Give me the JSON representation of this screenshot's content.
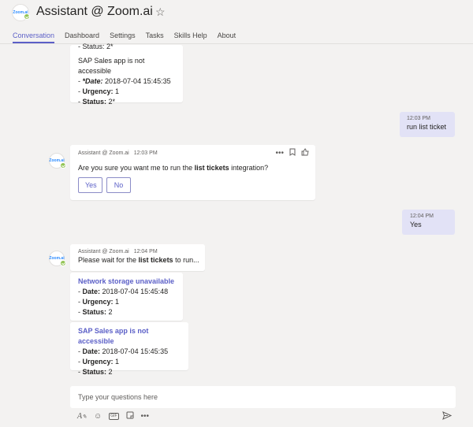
{
  "header": {
    "logo_text": "Zoom.ai",
    "title": "Assistant @ Zoom.ai",
    "tabs": [
      "Conversation",
      "Dashboard",
      "Settings",
      "Tasks",
      "Skills Help",
      "About"
    ]
  },
  "conversation": {
    "top_card": {
      "status_partial": "- Status: 2*",
      "title": "SAP Sales app is not accessible",
      "date_label": "*Date:",
      "date_value": "2018-07-04 15:45:35",
      "urgency_label": "Urgency:",
      "urgency_value": "1",
      "status_label": "Status:",
      "status_value": "2*"
    },
    "msg1": {
      "time": "12:03 PM",
      "text": "run list ticket"
    },
    "bot1": {
      "sender": "Assistant @ Zoom.ai",
      "time": "12:03 PM",
      "text_pre": "Are you sure you want me to run the ",
      "text_bold": "list tickets",
      "text_post": " integration?",
      "yes_label": "Yes",
      "no_label": "No"
    },
    "msg2": {
      "time": "12:04 PM",
      "text": "Yes"
    },
    "bot2": {
      "sender": "Assistant @ Zoom.ai",
      "time": "12:04 PM",
      "text_pre": "Please wait for the ",
      "text_bold": "list tickets",
      "text_post": " to run...",
      "ticket1": {
        "title": "Network storage unavailable",
        "date_label": "Date:",
        "date_value": "2018-07-04 15:45:48",
        "urgency_label": "Urgency:",
        "urgency_value": "1",
        "status_label": "Status:",
        "status_value": "2"
      },
      "ticket2": {
        "title": "SAP Sales app is not accessible",
        "date_label": "Date:",
        "date_value": "2018-07-04 15:45:35",
        "urgency_label": "Urgency:",
        "urgency_value": "1",
        "status_label": "Status:",
        "status_value": "2"
      }
    }
  },
  "compose": {
    "placeholder": "Type your questions here"
  },
  "colors": {
    "accent": "#5b5fc7",
    "presence": "#92c353",
    "my_bubble": "#e2e2f6"
  }
}
